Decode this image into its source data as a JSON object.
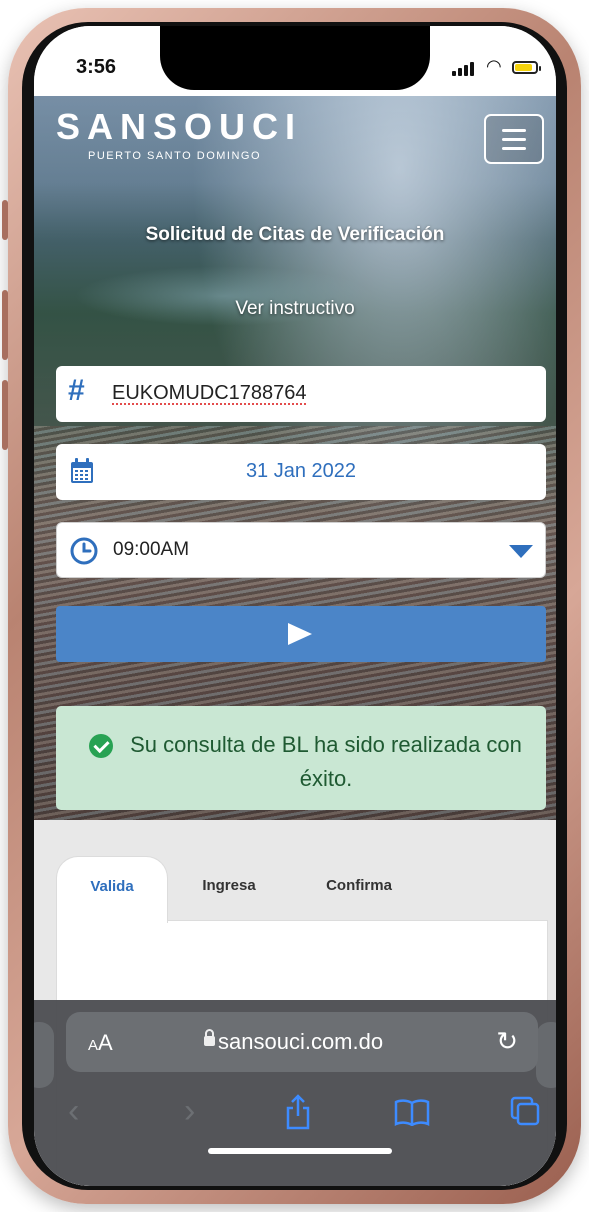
{
  "status_bar": {
    "time": "3:56"
  },
  "brand": {
    "name": "SANSOUCI",
    "subtitle": "PUERTO SANTO DOMINGO"
  },
  "header": {
    "title": "Solicitud de Citas de Verificación",
    "instructions_link": "Ver instructivo"
  },
  "form": {
    "bl_number": "EUKOMUDC1788764",
    "date": "31 Jan 2022",
    "time": "09:00AM"
  },
  "alert": {
    "message": "Su consulta de BL ha sido realizada con éxito."
  },
  "tabs": [
    {
      "label": "Valida",
      "active": true
    },
    {
      "label": "Ingresa",
      "active": false
    },
    {
      "label": "Confirma",
      "active": false
    }
  ],
  "browser": {
    "text_size_label_small": "A",
    "text_size_label_large": "A",
    "url": "sansouci.com.do"
  },
  "colors": {
    "accent": "#2f6fbd",
    "button": "#4b85c8",
    "success_bg": "#c9e7d3",
    "success_icon": "#28a253"
  },
  "icons": [
    "hash-icon",
    "calendar-icon",
    "clock-icon",
    "chevron-down-icon",
    "send-icon",
    "check-circle-icon",
    "lock-icon",
    "reload-icon",
    "back-icon",
    "forward-icon",
    "share-icon",
    "bookmarks-icon",
    "tabs-icon",
    "menu-icon"
  ]
}
